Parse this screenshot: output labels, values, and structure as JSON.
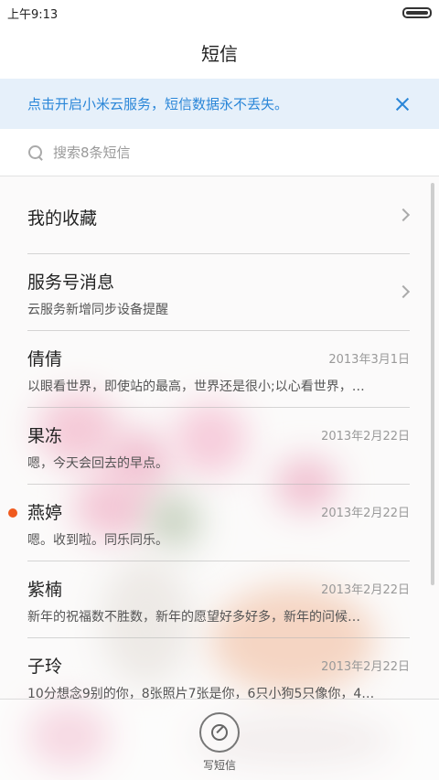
{
  "status_bar": {
    "time": "上午9:13"
  },
  "header": {
    "title": "短信"
  },
  "banner": {
    "text": "点击开启小米云服务，短信数据永不丢失。"
  },
  "search": {
    "placeholder": "搜索8条短信"
  },
  "favorites": {
    "label": "我的收藏"
  },
  "service": {
    "name": "服务号消息",
    "preview": "云服务新增同步设备提醒"
  },
  "conversations": [
    {
      "name": "倩倩",
      "date": "2013年3月1日",
      "preview": "以眼看世界，即使站的最高，世界还是很小;以心看世界，…",
      "unread": false
    },
    {
      "name": "果冻",
      "date": "2013年2月22日",
      "preview": "嗯，今天会回去的早点。",
      "unread": false
    },
    {
      "name": "燕婷",
      "date": "2013年2月22日",
      "preview": "嗯。收到啦。同乐同乐。",
      "unread": true
    },
    {
      "name": "紫楠",
      "date": "2013年2月22日",
      "preview": "新年的祝福数不胜数，新年的愿望好多好多，新年的问候…",
      "unread": false
    },
    {
      "name": "子玲",
      "date": "2013年2月22日",
      "preview": "10分想念9别的你，8张照片7张是你，6只小狗5只像你，4…",
      "unread": false
    }
  ],
  "bottom_bar": {
    "compose_label": "写短信"
  },
  "colors": {
    "accent": "#2a86d8",
    "banner_bg": "#e6f0fa",
    "unread_dot": "#f05a1e"
  }
}
